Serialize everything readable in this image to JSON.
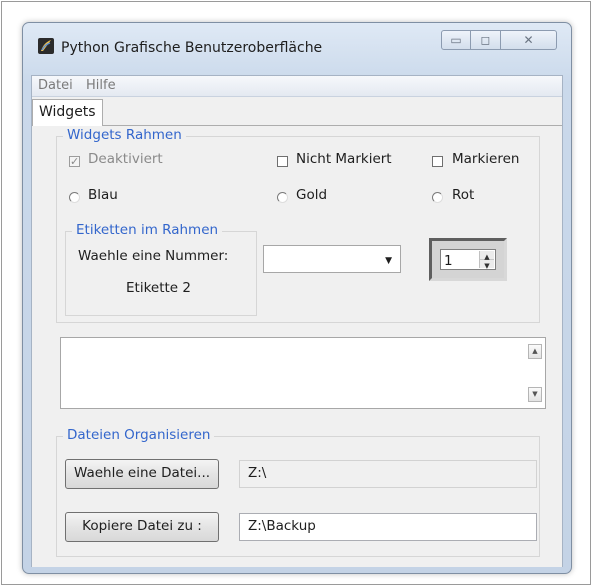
{
  "window": {
    "title": "Python Grafische Benutzeroberfläche",
    "controls": {
      "minimize": "▭",
      "maximize": "◻",
      "close": "✕"
    }
  },
  "menu": {
    "items": [
      "Datei",
      "Hilfe"
    ]
  },
  "tabs": [
    {
      "label": "Widgets"
    }
  ],
  "widgets_frame": {
    "title": "Widgets Rahmen",
    "checkboxes": [
      {
        "label": "Deaktiviert",
        "checked": true,
        "disabled": true
      },
      {
        "label": "Nicht Markiert",
        "checked": false
      },
      {
        "label": "Markieren",
        "checked": false
      }
    ],
    "radios": [
      {
        "label": "Blau"
      },
      {
        "label": "Gold"
      },
      {
        "label": "Rot"
      }
    ],
    "labels_frame": {
      "title": "Etiketten im Rahmen",
      "label1": "Waehle eine Nummer:",
      "label2": "Etikette 2"
    },
    "combobox": {
      "value": ""
    },
    "spinbox": {
      "value": "1"
    }
  },
  "scrolled_text": {
    "value": ""
  },
  "files_frame": {
    "title": "Dateien Organisieren",
    "choose_button": "Waehle eine Datei...",
    "choose_path": "Z:\\",
    "copy_button": "Kopiere Datei zu :",
    "copy_path": "Z:\\Backup"
  },
  "icons": {
    "app": "python-feather-icon",
    "combo_arrow": "▼",
    "spin_up": "▲",
    "spin_down": "▼",
    "scroll_up": "▲",
    "scroll_down": "▼",
    "check_mark": "✓"
  },
  "colors": {
    "group_title": "#3366cc",
    "window_frame": "#cad9eb",
    "client_bg": "#f0f0f0"
  }
}
